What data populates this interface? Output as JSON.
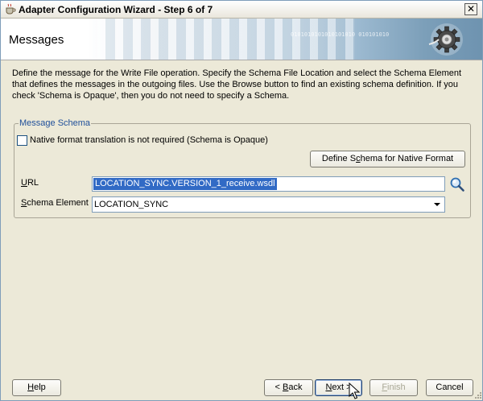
{
  "window": {
    "title": "Adapter Configuration Wizard - Step 6 of 7",
    "close_glyph": "✕"
  },
  "header": {
    "page_title": "Messages",
    "binary_decoration": "0101010101010101010 010101010"
  },
  "description": "Define the message for the Write File operation.  Specify the Schema File Location and select the Schema Element that defines the messages in the outgoing files. Use the Browse button to find an existing schema definition. If you check 'Schema is Opaque', then you do not need to specify a Schema.",
  "message_schema": {
    "legend": "Message Schema",
    "opaque_checkbox": {
      "label": "Native format translation is not required (Schema is Opaque)",
      "checked": false
    },
    "define_button": {
      "pre": "Define S",
      "key": "c",
      "post": "hema for Native Format"
    },
    "url": {
      "label_key": "U",
      "label_rest": "RL",
      "value": "LOCATION_SYNC.VERSION_1_receive.wsdl"
    },
    "schema_element": {
      "label_key": "S",
      "label_rest": "chema Element",
      "value": "LOCATION_SYNC"
    }
  },
  "buttons": {
    "help": {
      "key": "H",
      "rest": "elp"
    },
    "back": {
      "pre": "< ",
      "key": "B",
      "rest": "ack"
    },
    "next": {
      "key": "N",
      "rest": "ext >"
    },
    "finish": {
      "key": "F",
      "rest": "inish"
    },
    "cancel": {
      "label": "Cancel"
    }
  },
  "icons": {
    "app": "coffee-cup-icon",
    "banner": "gear-plug-icon",
    "browse": "magnifier-icon",
    "dropdown": "chevron-down-icon",
    "pointer": "cursor-icon"
  }
}
